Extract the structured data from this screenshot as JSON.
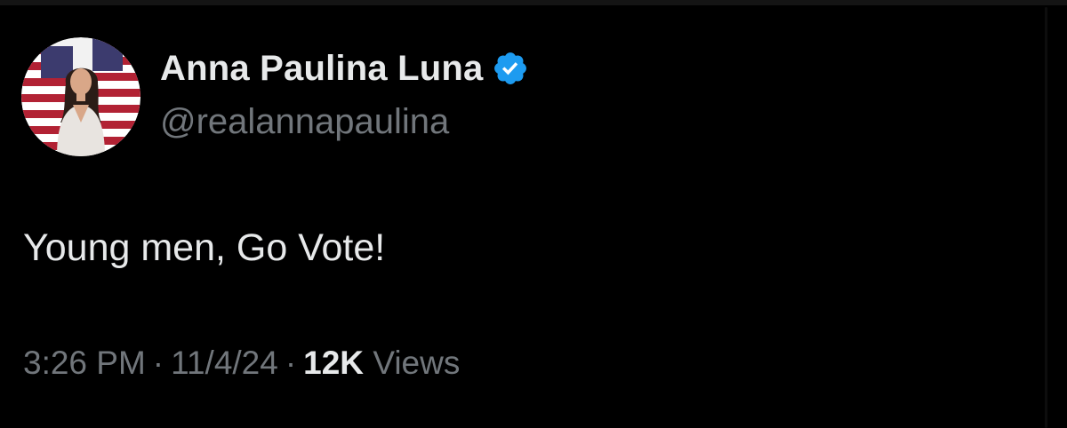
{
  "author": {
    "display_name": "Anna Paulina Luna",
    "handle": "@realannapaulina",
    "verified": true,
    "verified_color": "#1d9bf0"
  },
  "tweet": {
    "text": "Young men, Go Vote!"
  },
  "meta": {
    "time": "3:26 PM",
    "separator": "·",
    "date": "11/4/24",
    "views_count": "12K",
    "views_label": "Views"
  },
  "colors": {
    "background": "#000000",
    "primary_text": "#e7e9ea",
    "secondary_text": "#71767b"
  }
}
